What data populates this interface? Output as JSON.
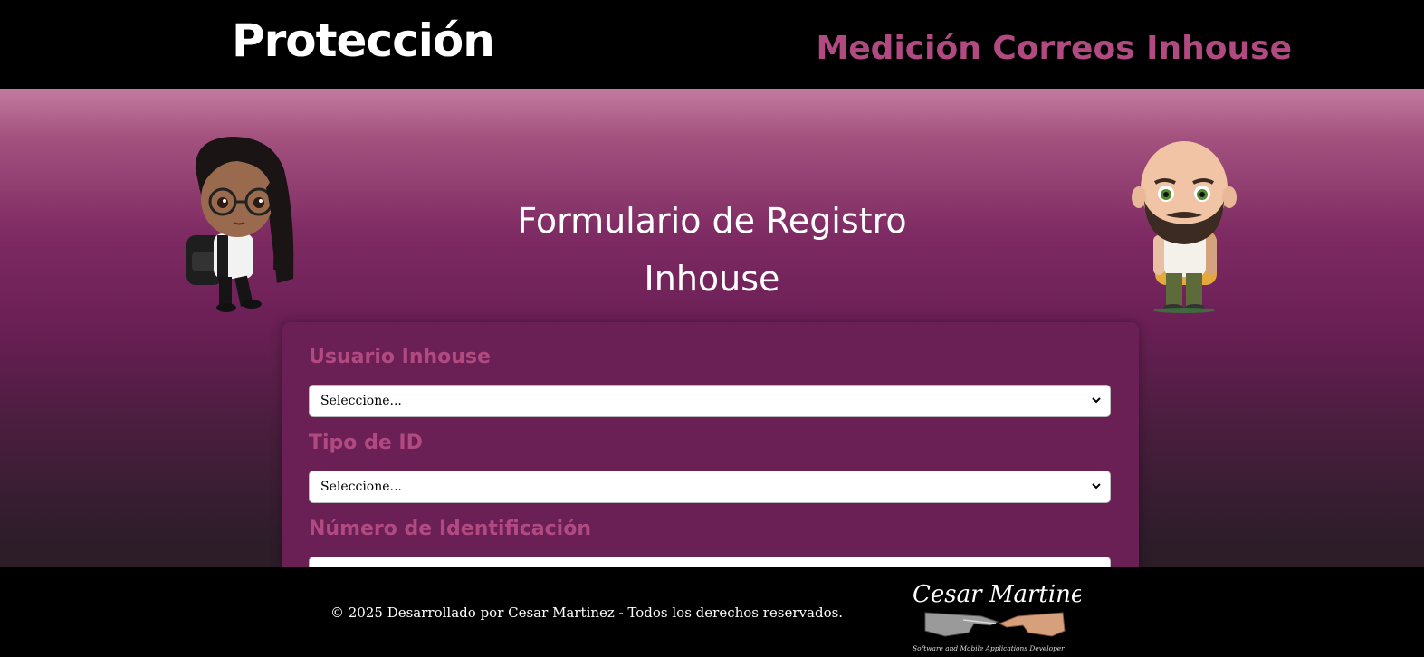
{
  "header": {
    "brand": "Protección",
    "app_title": "Medición Correos Inhouse"
  },
  "form": {
    "heading_line1": "Formulario de Registro",
    "heading_line2": "Inhouse",
    "fields": [
      {
        "label": "Usuario Inhouse",
        "value": "Seleccione..."
      },
      {
        "label": "Tipo de ID",
        "value": "Seleccione..."
      },
      {
        "label": "Número de Identificación",
        "value": ""
      }
    ]
  },
  "footer": {
    "copyright": "© 2025 Desarrollado por Cesar Martinez - Todos los derechos reservados.",
    "logo_name": "Cesar Martinez",
    "logo_tagline": "Software and Mobile Applications Developer"
  },
  "colors": {
    "accent": "#b24a82",
    "card": "#6a1f55",
    "bar": "#000000"
  }
}
